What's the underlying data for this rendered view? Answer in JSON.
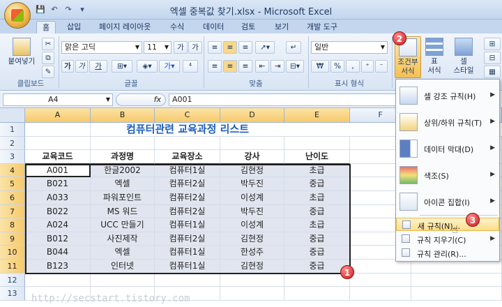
{
  "window": {
    "title": "엑셀 중복값 찾기.xlsx - Microsoft Excel"
  },
  "qat": {
    "save": "💾",
    "undo": "↶",
    "redo": "↷",
    "more": "▾"
  },
  "tabs": [
    "홈",
    "삽입",
    "페이지 레이아웃",
    "수식",
    "데이터",
    "검토",
    "보기",
    "개발 도구"
  ],
  "ribbon": {
    "groups": [
      "클립보드",
      "글꼴",
      "맞춤",
      "표시 형식"
    ],
    "paste_label": "붙여넣기",
    "font_name": "맑은 고딕",
    "font_size": "11",
    "number_format": "일반",
    "cond_format_label": "조건부\n서식",
    "cond_format_line1": "조건부",
    "cond_format_line2": "서식",
    "table_format_line1": "표",
    "table_format_line2": "서식",
    "cell_style_line1": "셀",
    "cell_style_line2": "스타일",
    "font_buttons": [
      "가",
      "가",
      "가"
    ],
    "percent_buttons": [
      "₩",
      "%",
      ","
    ]
  },
  "formula": {
    "name_box": "A4",
    "fx": "fx",
    "value": "A001"
  },
  "columns": [
    "A",
    "B",
    "C",
    "D",
    "E",
    "F"
  ],
  "rows": [
    "1",
    "2",
    "3",
    "4",
    "5",
    "6",
    "7",
    "8",
    "9",
    "10",
    "11",
    "12",
    "13"
  ],
  "sheet": {
    "title": "컴퓨터관련 교육과정 리스트",
    "headers": [
      "교육코드",
      "과정명",
      "교육장소",
      "강사",
      "난이도"
    ],
    "data": [
      [
        "A001",
        "한글2002",
        "컴퓨터1실",
        "김현정",
        "초급"
      ],
      [
        "B021",
        "엑셀",
        "컴퓨터2실",
        "박두진",
        "중급"
      ],
      [
        "A033",
        "파워포인트",
        "컴퓨터2실",
        "이성계",
        "초급"
      ],
      [
        "B022",
        "MS 워드",
        "컴퓨터2실",
        "박두진",
        "중급"
      ],
      [
        "A024",
        "UCC 만들기",
        "컴퓨터1실",
        "이성계",
        "초급"
      ],
      [
        "B012",
        "사진제작",
        "컴퓨터2실",
        "김현정",
        "중급"
      ],
      [
        "B044",
        "엑셀",
        "컴퓨터1실",
        "한성주",
        "중급"
      ],
      [
        "B123",
        "인터넷",
        "컴퓨터1실",
        "김현정",
        "중급"
      ]
    ]
  },
  "menu": {
    "items": [
      {
        "label": "셀 강조 규칙(H)",
        "icon": "highlight-cells-icon",
        "arrow": "▶"
      },
      {
        "label": "상위/하위 규칙(T)",
        "icon": "top-bottom-icon",
        "arrow": "▶"
      },
      {
        "label": "데이터 막대(D)",
        "icon": "data-bars-icon",
        "arrow": "▶"
      },
      {
        "label": "색조(S)",
        "icon": "color-scales-icon",
        "arrow": "▶"
      },
      {
        "label": "아이콘 집합(I)",
        "icon": "icon-sets-icon",
        "arrow": "▶"
      }
    ],
    "small_items": [
      {
        "label": "새 규칙(N)...",
        "arrow": ""
      },
      {
        "label": "규칙 지우기(C)",
        "arrow": "▶"
      },
      {
        "label": "규칙 관리(R)...",
        "arrow": ""
      }
    ]
  },
  "badges": [
    "1",
    "2",
    "3"
  ],
  "watermark": "http://secstart.tistory.com",
  "colors": {
    "selection": "#f7c96a",
    "badge": "#d01c1c",
    "title_text": "#1f5fbf"
  }
}
